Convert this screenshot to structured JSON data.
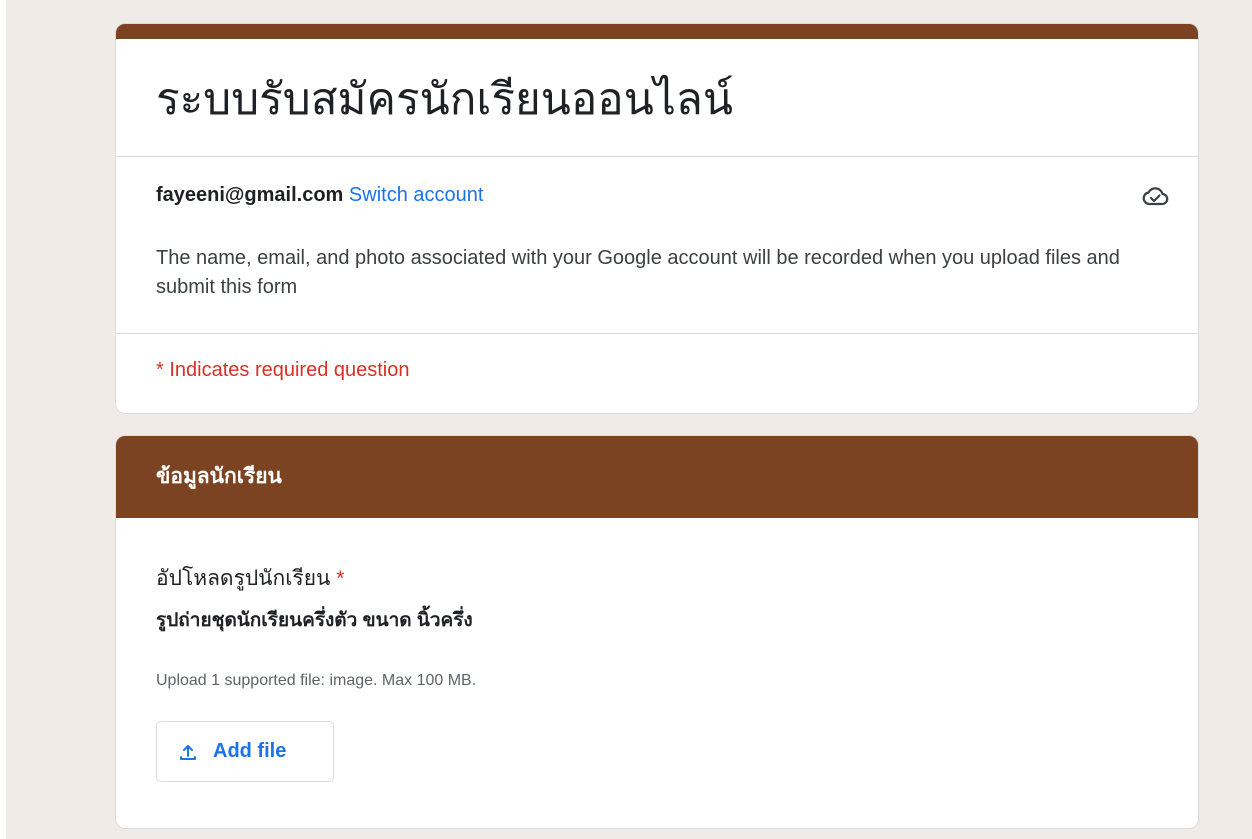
{
  "form": {
    "title": "ระบบรับสมัครนักเรียนออนไลน์",
    "account_email": "fayeeni@gmail.com",
    "switch_account_label": "Switch account",
    "notice": "The name, email, and photo associated with your Google account will be recorded when you upload files and submit this form",
    "required_note": "* Indicates required question"
  },
  "section": {
    "title": "ข้อมูลนักเรียน",
    "question": {
      "title": "อัปโหลดรูปนักเรียน",
      "required_mark": "*",
      "description": "รูปถ่ายชุดนักเรียนครึ่งตัว ขนาด นิ้วครึ่ง",
      "upload_hint": "Upload 1 supported file: image. Max 100 MB.",
      "add_file_label": "Add file"
    }
  },
  "icons": {
    "cloud": "cloud-check-icon",
    "upload": "upload-icon"
  },
  "colors": {
    "accent": "#7b4321",
    "link": "#1a73e8",
    "required": "#d93025",
    "background": "#f0ebe7"
  }
}
